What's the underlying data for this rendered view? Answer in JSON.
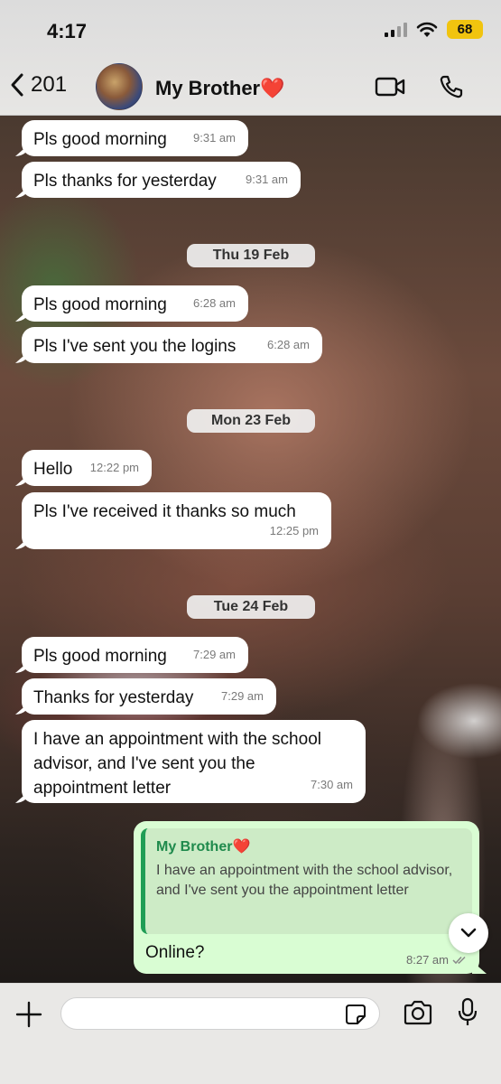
{
  "status_bar": {
    "time": "4:17",
    "battery": "68"
  },
  "header": {
    "back_count": "201",
    "contact_name": "My Brother❤️"
  },
  "messages": [
    {
      "text": "Pls good morning",
      "time": "9:31 am"
    },
    {
      "text": "Pls thanks for yesterday",
      "time": "9:31 am"
    },
    {
      "text": "Pls good morning",
      "time": "6:28 am"
    },
    {
      "text": "Pls I've sent you the logins",
      "time": "6:28 am"
    },
    {
      "text": "Hello",
      "time": "12:22 pm"
    },
    {
      "text": "Pls I've received it thanks so much",
      "time": "12:25 pm"
    },
    {
      "text": "Pls good morning",
      "time": "7:29 am"
    },
    {
      "text": "Thanks for yesterday",
      "time": "7:29 am"
    },
    {
      "text": "I have an appointment with the school advisor, and I've sent you the appointment letter",
      "time": "7:30 am"
    }
  ],
  "dates": [
    "Thu 19 Feb",
    "Mon 23 Feb",
    "Tue 24 Feb"
  ],
  "outgoing": {
    "quote_author": "My Brother❤️",
    "quote_text": "I have an appointment with the school advisor, and I've sent you the appointment letter",
    "text": "Online?",
    "time": "8:27 am"
  },
  "composer": {
    "placeholder": ""
  },
  "colors": {
    "incoming": "#ffffff",
    "outgoing": "#d9fdd3",
    "accent": "#1f9d55"
  }
}
